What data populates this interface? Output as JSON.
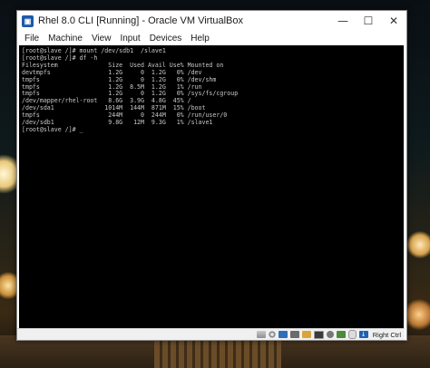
{
  "window": {
    "title": "Rhel 8.0 CLI [Running] - Oracle VM VirtualBox",
    "controls": {
      "minimize": "—",
      "maximize": "☐",
      "close": "✕"
    }
  },
  "menu": [
    "File",
    "Machine",
    "View",
    "Input",
    "Devices",
    "Help"
  ],
  "terminal": {
    "lines": [
      "[root@slave /]# mount /dev/sdb1  /slave1",
      "[root@slave /]# df -h",
      "Filesystem              Size  Used Avail Use% Mounted on",
      "devtmpfs                1.2G     0  1.2G   0% /dev",
      "tmpfs                   1.2G     0  1.2G   0% /dev/shm",
      "tmpfs                   1.2G  8.5M  1.2G   1% /run",
      "tmpfs                   1.2G     0  1.2G   0% /sys/fs/cgroup",
      "/dev/mapper/rhel-root   8.6G  3.9G  4.8G  45% /",
      "/dev/sda1              1014M  144M  871M  15% /boot",
      "tmpfs                   244M     0  244M   0% /run/user/0",
      "/dev/sdb1               9.8G   12M  9.3G   1% /slave1",
      "[root@slave /]# _"
    ]
  },
  "statusbar": {
    "icons": [
      "hard-disk-icon",
      "optical-drive-icon",
      "network-icon",
      "usb-icon",
      "shared-folder-icon",
      "display-icon",
      "recording-icon",
      "cpu-icon",
      "mouse-integration-icon",
      "host-key-arrow-icon"
    ],
    "host_key": "Right Ctrl"
  }
}
